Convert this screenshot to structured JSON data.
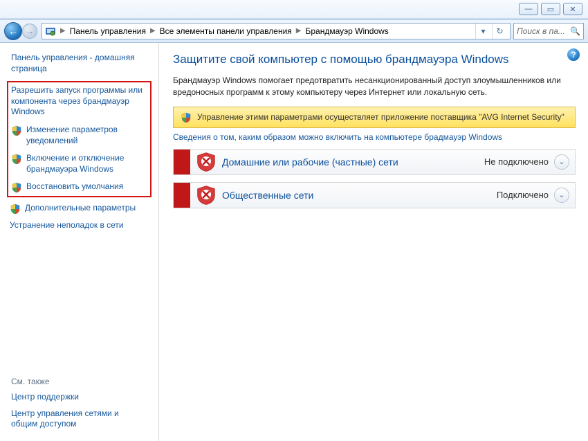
{
  "window_controls": {
    "min": "—",
    "max": "▭",
    "close": "✕"
  },
  "breadcrumbs": {
    "items": [
      "Панель управления",
      "Все элементы панели управления",
      "Брандмауэр Windows"
    ]
  },
  "search": {
    "placeholder": "Поиск в па..."
  },
  "sidebar": {
    "home": "Панель управления - домашняя страница",
    "highlighted": [
      "Разрешить запуск программы или компонента через брандмауэр Windows",
      "Изменение параметров уведомлений",
      "Включение и отключение брандмауэра Windows",
      "Восстановить умолчания"
    ],
    "extra": [
      "Дополнительные параметры",
      "Устранение неполадок в сети"
    ],
    "see_also_heading": "См. также",
    "see_also": [
      "Центр поддержки",
      "Центр управления сетями и общим доступом"
    ]
  },
  "main": {
    "title": "Защитите свой компьютер с помощью брандмауэра Windows",
    "description": "Брандмауэр Windows помогает предотвратить несанкционированный доступ злоумышленников или вредоносных программ к этому компьютеру через Интернет или локальную сеть.",
    "banner": "Управление этими параметрами осуществляет приложение поставщика \"AVG Internet Security\"",
    "help_link": "Сведения о том, каким образом можно включить на компьютере брадмауэр Windows",
    "networks": [
      {
        "title": "Домашние или рабочие (частные) сети",
        "status": "Не подключено"
      },
      {
        "title": "Общественные сети",
        "status": "Подключено"
      }
    ]
  }
}
